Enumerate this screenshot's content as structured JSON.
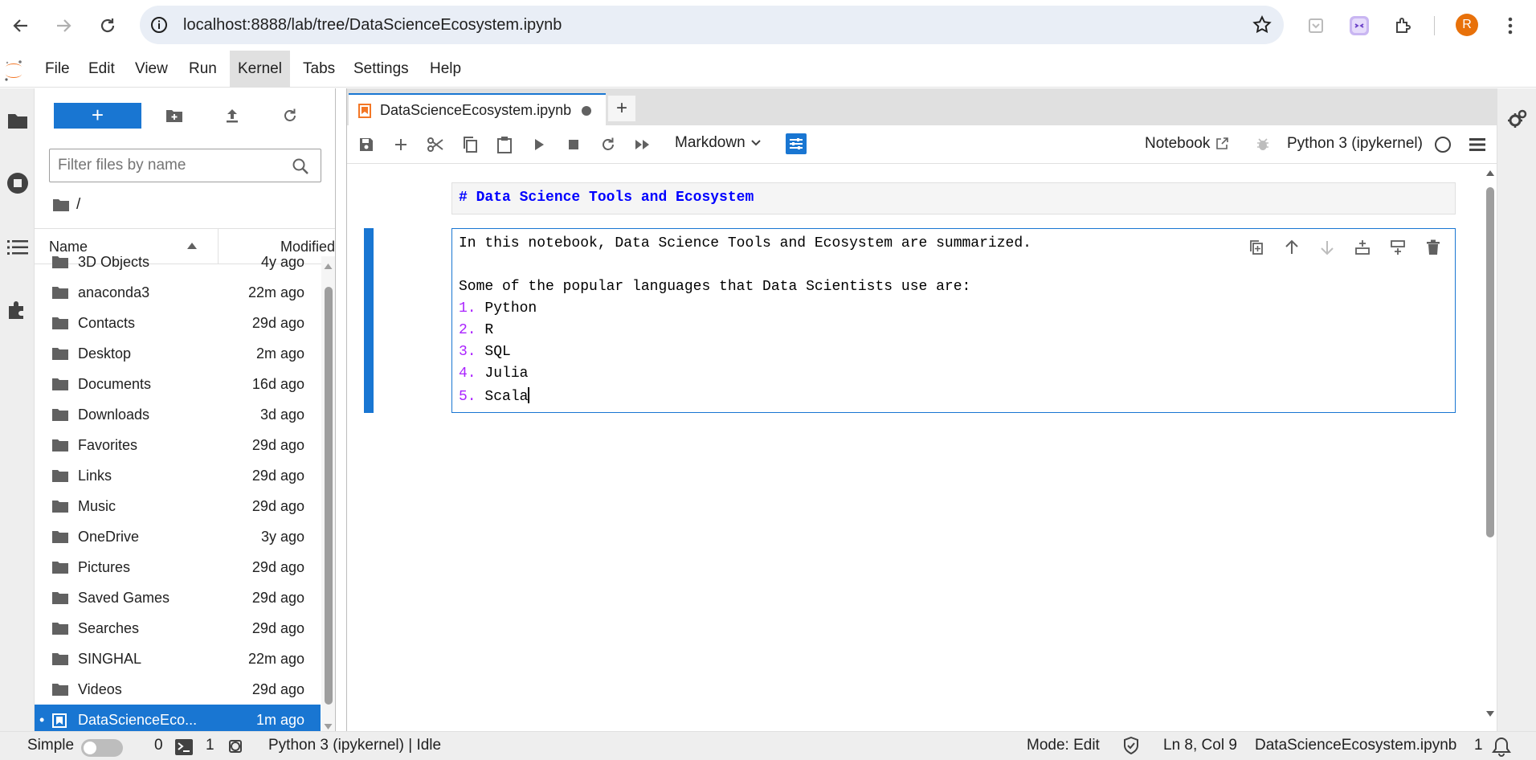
{
  "browser": {
    "url": "localhost:8888/lab/tree/DataScienceEcosystem.ipynb",
    "avatar_letter": "R"
  },
  "menu": [
    "File",
    "Edit",
    "View",
    "Run",
    "Kernel",
    "Tabs",
    "Settings",
    "Help"
  ],
  "filebrowser": {
    "new_label": "+",
    "filter_placeholder": "Filter files by name",
    "breadcrumb": "/",
    "col_name": "Name",
    "col_modified": "Modified",
    "items": [
      {
        "name": "3D Objects",
        "modified": "4y ago"
      },
      {
        "name": "anaconda3",
        "modified": "22m ago"
      },
      {
        "name": "Contacts",
        "modified": "29d ago"
      },
      {
        "name": "Desktop",
        "modified": "2m ago"
      },
      {
        "name": "Documents",
        "modified": "16d ago"
      },
      {
        "name": "Downloads",
        "modified": "3d ago"
      },
      {
        "name": "Favorites",
        "modified": "29d ago"
      },
      {
        "name": "Links",
        "modified": "29d ago"
      },
      {
        "name": "Music",
        "modified": "29d ago"
      },
      {
        "name": "OneDrive",
        "modified": "3y ago"
      },
      {
        "name": "Pictures",
        "modified": "29d ago"
      },
      {
        "name": "Saved Games",
        "modified": "29d ago"
      },
      {
        "name": "Searches",
        "modified": "29d ago"
      },
      {
        "name": "SINGHAL",
        "modified": "22m ago"
      },
      {
        "name": "Videos",
        "modified": "29d ago"
      }
    ],
    "selected": {
      "name": "DataScienceEco...",
      "modified": "1m ago"
    }
  },
  "tab": {
    "label": "DataScienceEcosystem.ipynb"
  },
  "toolbar": {
    "cell_type": "Markdown",
    "notebook_label": "Notebook",
    "kernel_label": "Python 3 (ipykernel)"
  },
  "cells": {
    "heading_source": "# Data Science Tools and Ecosystem",
    "edit_lines": [
      {
        "num": "",
        "text": "In this notebook, Data Science Tools and Ecosystem are summarized."
      },
      {
        "num": "",
        "text": ""
      },
      {
        "num": "",
        "text": "Some of the popular languages that Data Scientists use are:"
      },
      {
        "num": "1.",
        "text": "Python"
      },
      {
        "num": "2.",
        "text": "R"
      },
      {
        "num": "3.",
        "text": "SQL"
      },
      {
        "num": "4.",
        "text": "Julia"
      },
      {
        "num": "5.",
        "text": "Scala"
      }
    ]
  },
  "status": {
    "mode_label": "Simple",
    "count_a": "0",
    "count_b": "1",
    "kernel_state": "Python 3 (ipykernel) | Idle",
    "edit_mode": "Mode: Edit",
    "cursor": "Ln 8, Col 9",
    "filename": "DataScienceEcosystem.ipynb",
    "notif_count": "1"
  }
}
